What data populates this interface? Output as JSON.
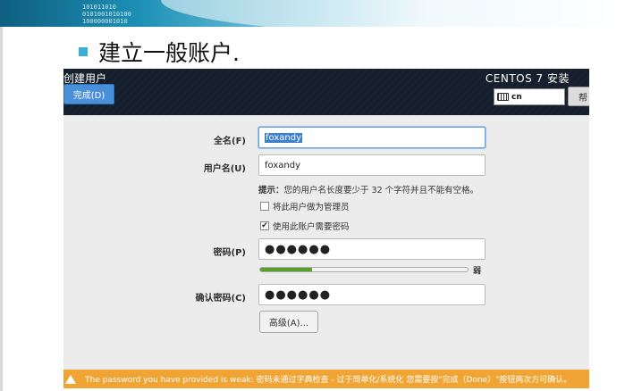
{
  "slide": {
    "title": "建立一般账户.",
    "banner_digits": "101011010\n0101001010100\n100000001010"
  },
  "installer": {
    "header_title": "创建用户",
    "done_label": "完成(D)",
    "product": "CENTOS 7 安装",
    "keyboard_layout": "cn",
    "help_label": "帮",
    "fullname_label": "全名(F)",
    "fullname_value": "foxandy",
    "username_label": "用户名(U)",
    "username_value": "foxandy",
    "hint_prefix": "提示：",
    "hint_text": "您的用户名长度要少于 32 个字符并且不能有空格。",
    "admin_checkbox": {
      "label": "将此用户做为管理员",
      "checked": false
    },
    "require_pw_checkbox": {
      "label": "使用此账户需要密码",
      "checked": true
    },
    "password_label": "密码(P)",
    "password_value": "●●●●●●",
    "strength": {
      "level_percent": 25,
      "label": "弱"
    },
    "confirm_label": "确认密码(C)",
    "confirm_value": "●●●●●●",
    "advanced_label": "高级(A)...",
    "warning_text": "The password you have provided is weak: 密码未通过字典检查 - 过于简单化/系统化 您需要按\"完成（Done）\"按钮两次方可确认。",
    "colors": {
      "header": "#151e2c",
      "accent": "#4a90d9",
      "warning": "#f0a434",
      "strength": "#5aa02c"
    }
  }
}
